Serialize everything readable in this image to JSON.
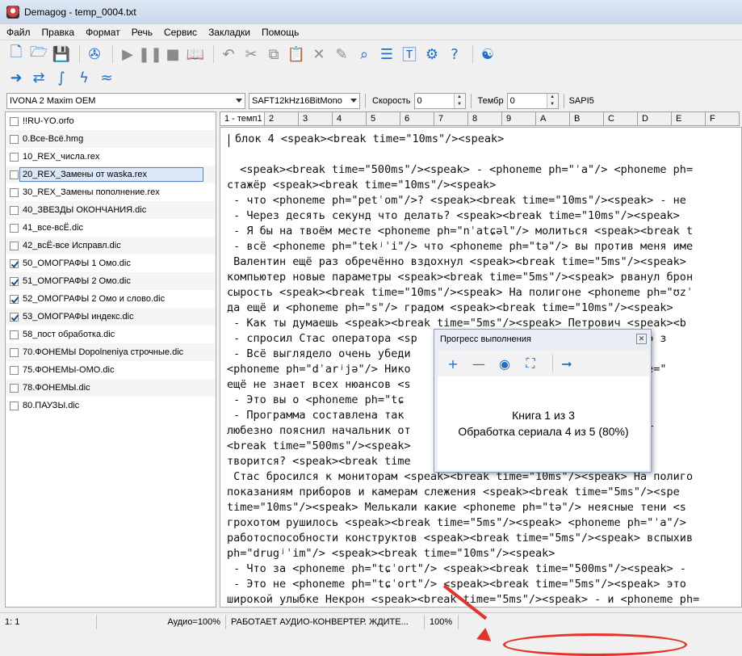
{
  "window": {
    "title": "Demagog - temp_0004.txt"
  },
  "menu": [
    "Файл",
    "Правка",
    "Формат",
    "Речь",
    "Сервис",
    "Закладки",
    "Помощь"
  ],
  "toolbar": {
    "voice": "IVONA 2 Maxim OEM",
    "format": "SAFT12kHz16BitMono",
    "speed_label": "Скорость",
    "speed_value": "0",
    "timbre_label": "Тембр",
    "timbre_value": "0",
    "engine": "SAPI5"
  },
  "sidebar": {
    "items": [
      {
        "label": "!!RU-YO.orfo",
        "checked": false
      },
      {
        "label": "0.Все-Всё.hmg",
        "checked": false
      },
      {
        "label": "10_REX_числа.rex",
        "checked": false
      },
      {
        "label": "20_REX_Замены от waska.rex",
        "checked": false,
        "selected": true
      },
      {
        "label": "30_REX_Замены пополнение.rex",
        "checked": false
      },
      {
        "label": "40_ЗВЕЗДЫ ОКОНЧАНИЯ.dic",
        "checked": false
      },
      {
        "label": "41_все-всЁ.dic",
        "checked": false
      },
      {
        "label": "42_всЁ-все Исправл.dic",
        "checked": false
      },
      {
        "label": "50_ОМОГРАФЫ 1 Омо.dic",
        "checked": true
      },
      {
        "label": "51_ОМОГРАФЫ 2 Омо.dic",
        "checked": true
      },
      {
        "label": "52_ОМОГРАФЫ 2 Омо и слово.dic",
        "checked": true
      },
      {
        "label": "53_ОМОГРАФЫ индекс.dic",
        "checked": true
      },
      {
        "label": "58_пост обработка.dic",
        "checked": false
      },
      {
        "label": "70.ФОНЕМЫ Dopolneniya строчные.dic",
        "checked": false
      },
      {
        "label": "75.ФОНЕМЫ-ОМО.dic",
        "checked": false
      },
      {
        "label": "78.ФОНЕМЫ.dic",
        "checked": false
      },
      {
        "label": "80.ПАУЗЫ.dic",
        "checked": false
      }
    ]
  },
  "tabs": [
    "1 - темп1",
    "2",
    "3",
    "4",
    "5",
    "6",
    "7",
    "8",
    "9",
    "A",
    "B",
    "C",
    "D",
    "E",
    "F"
  ],
  "editor": {
    "lines": [
      "блок 4 <speak><break time=\"10ms\"/><speak>",
      "",
      "  <speak><break time=\"500ms\"/><speak> - <phoneme ph=\"ˈa\"/> <phoneme ph=",
      "стажёр <speak><break time=\"10ms\"/><speak>",
      " - что <phoneme ph=\"petˈom\"/>? <speak><break time=\"10ms\"/><speak> - не",
      " - Через десять секунд что делать? <speak><break time=\"10ms\"/><speak>",
      " - Я бы на твоём месте <phoneme ph=\"nˈatɕəl\"/> молиться <speak><break t",
      " - всё <phoneme ph=\"tekʲˈi\"/> что <phoneme ph=\"tə\"/> вы против меня име",
      " Валентин ещё раз обречённо вздохнул <speak><break time=\"5ms\"/><speak>",
      "компьютер новые параметры <speak><break time=\"5ms\"/><speak> рванул брон",
      "сырость <speak><break time=\"10ms\"/><speak> На полигоне <phoneme ph=\"ʊzˈ",
      "да ещё и <phoneme ph=\"s\"/> градом <speak><break time=\"10ms\"/><speak>",
      " - Как ты думаешь <speak><break time=\"5ms\"/><speak> Петрович <speak><b",
      " - спросил Стас оператора <sp                          как только з",
      " - Всё выглядело очень убеди                          /><speak> -",
      "<phoneme ph=\"dˈarʲjə\"/> Нико                          <break time=\"",
      "ещё не знает всех нюансов <s                          k>",
      " - Это вы о <phoneme ph=\"tɕ                          /><speak> -",
      " - Программа составлена так                           > что неко",
      "любезно пояснил начальник от                          <speak> - Т",
      "<break time=\"500ms\"/><speak>                          ak> Петрое",
      "творится? <speak><break time",
      " Стас бросился к мониторам <speak><break time=\"10ms\"/><speak> На полиго",
      "показаниям приборов и камерам слежения <speak><break time=\"5ms\"/><spe",
      "time=\"10ms\"/><speak> Мелькали какие <phoneme ph=\"tə\"/> неясные тени <s",
      "грохотом рушилось <speak><break time=\"5ms\"/><speak> <phoneme ph=\"ˈa\"/>",
      "работоспособности конструктов <speak><break time=\"5ms\"/><speak> вспыхив",
      "ph=\"drugʲˈim\"/> <speak><break time=\"10ms\"/><speak>",
      " - Что за <phoneme ph=\"tɕˈort\"/> <speak><break time=\"500ms\"/><speak> -",
      " - Это не <phoneme ph=\"tɕˈort\"/> <speak><break time=\"5ms\"/><speak> это",
      "широкой улыбке Некрон <speak><break time=\"5ms\"/><speak> - и <phoneme ph="
    ]
  },
  "status": {
    "position": "1: 1",
    "audio": "Аудио=100%",
    "message": "РАБОТАЕТ АУДИО-КОНВЕРТЕР. ЖДИТЕ...",
    "zoom": "100%"
  },
  "progress_dialog": {
    "title": "Прогресс выполнения",
    "line1": "Книга 1 из 3",
    "line2": "Обработка сериала 4 из 5 (80%)"
  },
  "colors": {
    "annotation": "#e63327",
    "accent": "#1e6fc8"
  }
}
